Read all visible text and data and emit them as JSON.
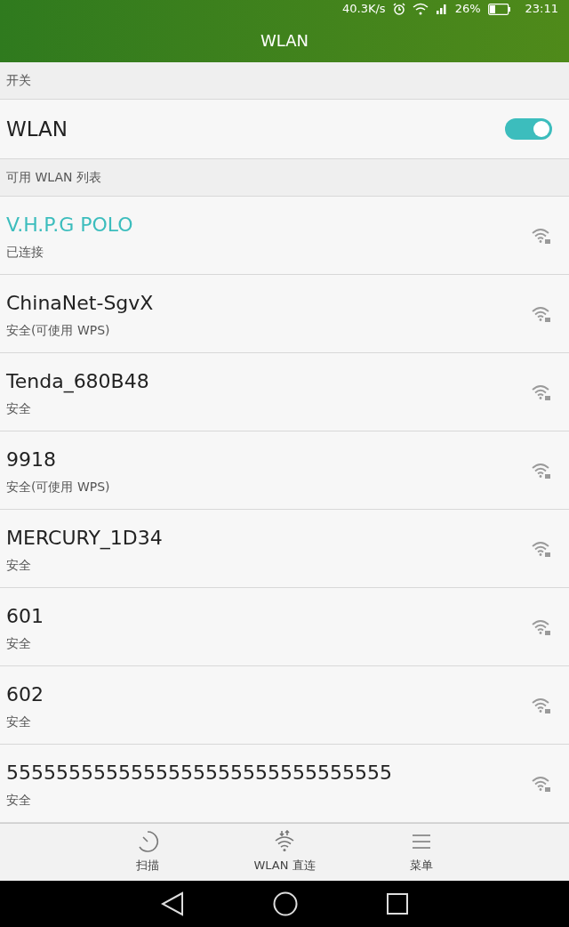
{
  "status_bar": {
    "speed": "40.3K/s",
    "battery": "26%",
    "time": "23:11"
  },
  "title": "WLAN",
  "switch_section": {
    "header": "开关",
    "label": "WLAN",
    "on": true
  },
  "networks_section": {
    "header": "可用 WLAN 列表",
    "networks": [
      {
        "name": "V.H.P.G POLO",
        "status": "已连接",
        "connected": true
      },
      {
        "name": "ChinaNet-SgvX",
        "status": "安全(可使用 WPS)",
        "connected": false
      },
      {
        "name": "Tenda_680B48",
        "status": "安全",
        "connected": false
      },
      {
        "name": "9918",
        "status": "安全(可使用 WPS)",
        "connected": false
      },
      {
        "name": "MERCURY_1D34",
        "status": "安全",
        "connected": false
      },
      {
        "name": "601",
        "status": "安全",
        "connected": false
      },
      {
        "name": "602",
        "status": "安全",
        "connected": false
      },
      {
        "name": "5555555555555555555555555555555",
        "status": "安全",
        "connected": false
      }
    ]
  },
  "bottom_actions": [
    {
      "kind": "scan",
      "label": "扫描"
    },
    {
      "kind": "direct",
      "label": "WLAN 直连"
    },
    {
      "kind": "menu",
      "label": "菜单"
    }
  ]
}
